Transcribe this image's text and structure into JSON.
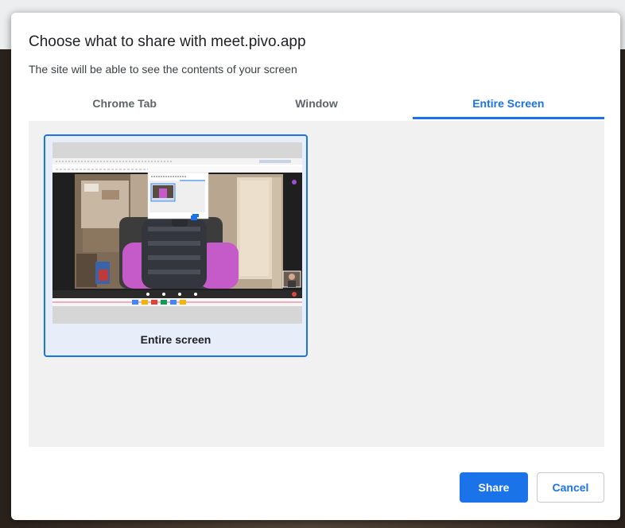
{
  "dialog": {
    "title": "Choose what to share with meet.pivo.app",
    "subtitle": "The site will be able to see the contents of your screen"
  },
  "tabs": [
    {
      "label": "Chrome Tab",
      "active": false
    },
    {
      "label": "Window",
      "active": false
    },
    {
      "label": "Entire Screen",
      "active": true
    }
  ],
  "sources": [
    {
      "label": "Entire screen",
      "selected": true
    }
  ],
  "buttons": {
    "share_label": "Share",
    "cancel_label": "Cancel"
  },
  "colors": {
    "accent": "#1a73e8",
    "panel_bg": "#f1f1f1"
  }
}
